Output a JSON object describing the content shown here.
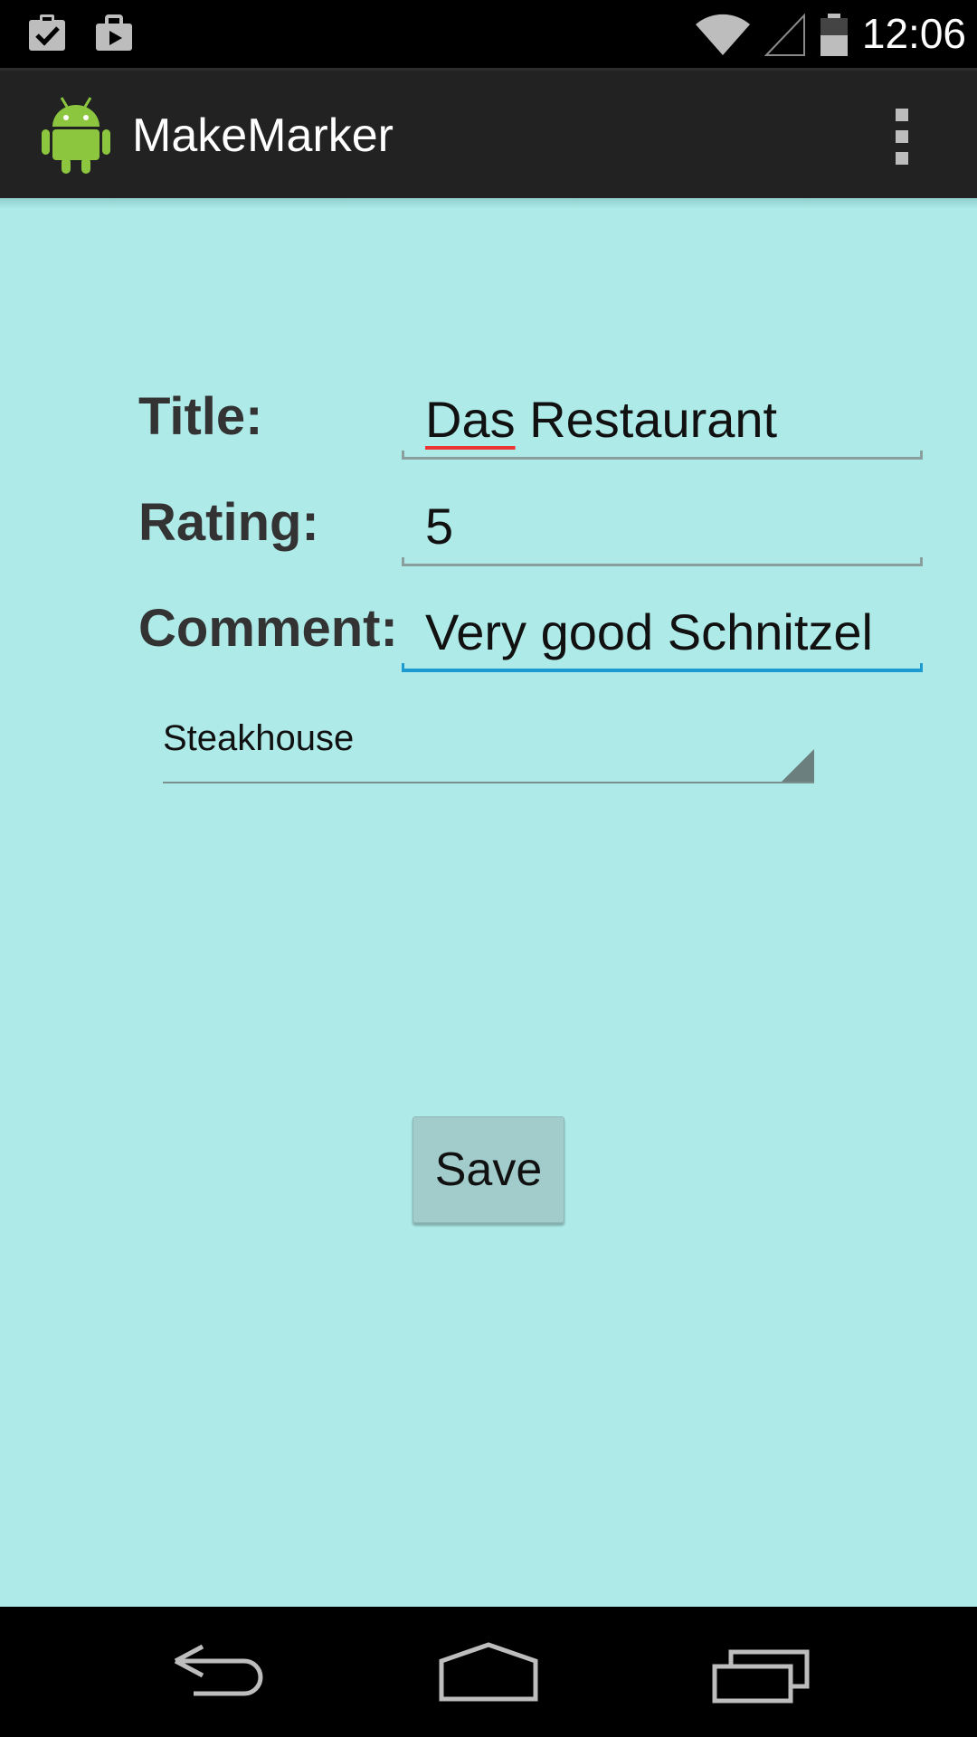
{
  "status_bar": {
    "time": "12:06",
    "notification_icons": [
      "clipboard-check-icon",
      "briefcase-icon"
    ],
    "system_icons": [
      "wifi-icon",
      "signal-icon",
      "battery-icon"
    ]
  },
  "action_bar": {
    "title": "MakeMarker",
    "logo_icon": "android-robot-icon",
    "overflow_icon": "overflow-menu-icon"
  },
  "form": {
    "title_label": "Title:",
    "title_value": "Das Restaurant",
    "title_value_misspelled_word": "Das",
    "title_value_rest": " Restaurant",
    "rating_label": "Rating:",
    "rating_value": "5",
    "comment_label": "Comment:",
    "comment_value": "Very good Schnitzel",
    "category_selected": "Steakhouse",
    "save_label": "Save"
  },
  "colors": {
    "background": "#adeae8",
    "focus_accent": "#1c9bd1",
    "spellcheck": "#ee3333",
    "action_bar": "#222222",
    "button": "#a2cccc"
  },
  "nav_bar": {
    "buttons": [
      "back-icon",
      "home-icon",
      "recents-icon"
    ]
  }
}
